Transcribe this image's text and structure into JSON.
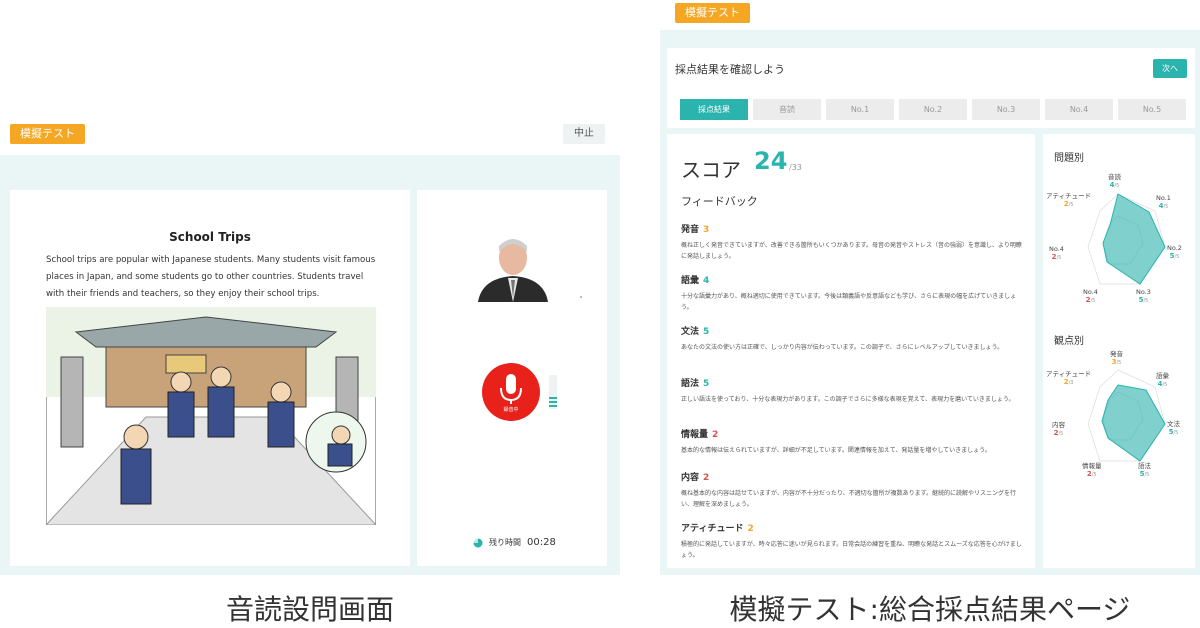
{
  "left": {
    "badge": "模擬テスト",
    "abort_label": "中止",
    "reading_title": "School Trips",
    "reading_text": "School trips are popular with Japanese students. Many students visit famous places in Japan, and some students go to other countries. Students travel with their friends and teachers, so they enjoy their school trips.",
    "mic_status": "録音中",
    "timer_label": "残り時間",
    "timer_value": "00:28",
    "caption": "音読設問画面"
  },
  "right": {
    "badge": "模擬テスト",
    "heading": "採点結果を確認しよう",
    "next_label": "次へ",
    "tabs": [
      "採点結果",
      "音読",
      "No.1",
      "No.2",
      "No.3",
      "No.4",
      "No.5"
    ],
    "score_label": "スコア",
    "score_value": "24",
    "score_total": "/33",
    "feedback_title": "フィードバック",
    "feedback": [
      {
        "name": "発音",
        "score": "3",
        "text": "概ね正しく発音できていますが、改善できる箇所もいくつかあります。母音の発音やストレス（音の強弱）を意識し、より明瞭に発話しましょう。"
      },
      {
        "name": "語彙",
        "score": "4",
        "text": "十分な語彙力があり、概ね適切に使用できています。今後は類義語や反意語なども学び、さらに表現の幅を広げていきましょう。"
      },
      {
        "name": "文法",
        "score": "5",
        "text": "あなたの文法の使い方は正確で、しっかり内容が伝わっています。この調子で、さらにレベルアップしていきましょう。"
      },
      {
        "name": "語法",
        "score": "5",
        "text": "正しい語法を使っており、十分な表現力があります。この調子でさらに多様な表現を覚えて、表現力を磨いていきましょう。"
      },
      {
        "name": "情報量",
        "score": "2",
        "text": "基本的な情報は伝えられていますが、詳細が不足しています。関連情報を加えて、発話量を増やしていきましょう。"
      },
      {
        "name": "内容",
        "score": "2",
        "text": "概ね基本的な内容は話せていますが、内容が不十分だったり、不適切な箇所が複数あります。継続的に読解やリスニングを行い、理解を深めましょう。"
      },
      {
        "name": "アティチュード",
        "score": "2",
        "text": "積極的に発話していますが、時々応答に迷いが見られます。日常会話の練習を重ね、明瞭な発話とスムーズな応答を心がけましょう。"
      }
    ],
    "by_question_title": "問題別",
    "by_question": [
      {
        "name": "音読",
        "score": "4",
        "max": "/5"
      },
      {
        "name": "No.1",
        "score": "4",
        "max": "/5"
      },
      {
        "name": "No.2",
        "score": "5",
        "max": "/5"
      },
      {
        "name": "No.3",
        "score": "5",
        "max": "/5"
      },
      {
        "name": "No.4",
        "score": "2",
        "max": "/5"
      },
      {
        "name": "No.4",
        "score": "2",
        "max": "/5"
      },
      {
        "name": "アティチュード",
        "score": "2",
        "max": "/5"
      }
    ],
    "by_aspect_title": "観点別",
    "by_aspect": [
      {
        "name": "発音",
        "score": "3",
        "max": "/5"
      },
      {
        "name": "語彙",
        "score": "4",
        "max": "/5"
      },
      {
        "name": "文法",
        "score": "5",
        "max": "/5"
      },
      {
        "name": "語法",
        "score": "5",
        "max": "/5"
      },
      {
        "name": "情報量",
        "score": "2",
        "max": "/5"
      },
      {
        "name": "内容",
        "score": "2",
        "max": "/5"
      },
      {
        "name": "アティチュード",
        "score": "2",
        "max": "/3"
      }
    ],
    "caption": "模擬テスト:総合採点結果ページ"
  },
  "colors": {
    "accent": "#2bb3ad",
    "badge": "#f5a623",
    "mic": "#e8221b",
    "low": "#d9534f"
  }
}
